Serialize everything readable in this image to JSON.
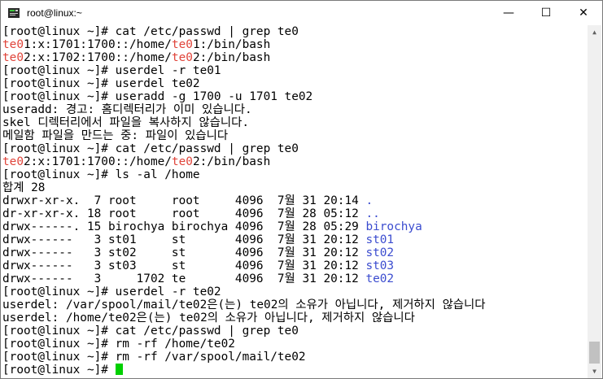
{
  "window": {
    "title": "root@linux:~",
    "minimize_label": "—",
    "maximize_label": "☐",
    "close_label": "✕"
  },
  "terminal": {
    "lines": [
      [
        {
          "t": "[root@linux ~]# cat /etc/passwd | grep te0"
        }
      ],
      [
        {
          "t": "te0",
          "c": "red"
        },
        {
          "t": "1:x:1701:1700::/home/"
        },
        {
          "t": "te0",
          "c": "red"
        },
        {
          "t": "1:/bin/bash"
        }
      ],
      [
        {
          "t": "te0",
          "c": "red"
        },
        {
          "t": "2:x:1702:1700::/home/"
        },
        {
          "t": "te0",
          "c": "red"
        },
        {
          "t": "2:/bin/bash"
        }
      ],
      [
        {
          "t": "[root@linux ~]# userdel -r te01"
        }
      ],
      [
        {
          "t": "[root@linux ~]# userdel te02"
        }
      ],
      [
        {
          "t": "[root@linux ~]# useradd -g 1700 -u 1701 te02"
        }
      ],
      [
        {
          "t": "useradd: 경고: 홈디렉터리가 이미 있습니다."
        }
      ],
      [
        {
          "t": "skel 디렉터리에서 파일을 복사하지 않습니다."
        }
      ],
      [
        {
          "t": "메일함 파일을 만드는 중: 파일이 있습니다"
        }
      ],
      [
        {
          "t": "[root@linux ~]# cat /etc/passwd | grep te0"
        }
      ],
      [
        {
          "t": "te0",
          "c": "red"
        },
        {
          "t": "2:x:1701:1700::/home/"
        },
        {
          "t": "te0",
          "c": "red"
        },
        {
          "t": "2:/bin/bash"
        }
      ],
      [
        {
          "t": "[root@linux ~]# ls -al /home"
        }
      ],
      [
        {
          "t": "합계 28"
        }
      ],
      [
        {
          "t": "drwxr-xr-x.  7 root     root     4096  7월 31 20:14 "
        },
        {
          "t": ".",
          "c": "blue"
        }
      ],
      [
        {
          "t": "dr-xr-xr-x. 18 root     root     4096  7월 28 05:12 "
        },
        {
          "t": "..",
          "c": "blue"
        }
      ],
      [
        {
          "t": "drwx------. 15 birochya birochya 4096  7월 28 05:29 "
        },
        {
          "t": "birochya",
          "c": "blue"
        }
      ],
      [
        {
          "t": "drwx------   3 st01     st       4096  7월 31 20:12 "
        },
        {
          "t": "st01",
          "c": "blue"
        }
      ],
      [
        {
          "t": "drwx------   3 st02     st       4096  7월 31 20:12 "
        },
        {
          "t": "st02",
          "c": "blue"
        }
      ],
      [
        {
          "t": "drwx------   3 st03     st       4096  7월 31 20:12 "
        },
        {
          "t": "st03",
          "c": "blue"
        }
      ],
      [
        {
          "t": "drwx------   3     1702 te       4096  7월 31 20:12 "
        },
        {
          "t": "te02",
          "c": "blue"
        }
      ],
      [
        {
          "t": "[root@linux ~]# userdel -r te02"
        }
      ],
      [
        {
          "t": "userdel: /var/spool/mail/te02은(는) te02의 소유가 아닙니다, 제거하지 않습니다"
        }
      ],
      [
        {
          "t": "userdel: /home/te02은(는) te02의 소유가 아닙니다, 제거하지 않습니다"
        }
      ],
      [
        {
          "t": "[root@linux ~]# cat /etc/passwd | grep te0"
        }
      ],
      [
        {
          "t": "[root@linux ~]# rm -rf /home/te02"
        }
      ],
      [
        {
          "t": "[root@linux ~]# rm -rf /var/spool/mail/te02"
        }
      ],
      [
        {
          "t": "[root@linux ~]# "
        }
      ]
    ],
    "colors": {
      "red": "#e0443a",
      "blue": "#3b4ccf",
      "cursor": "#00d000"
    }
  }
}
